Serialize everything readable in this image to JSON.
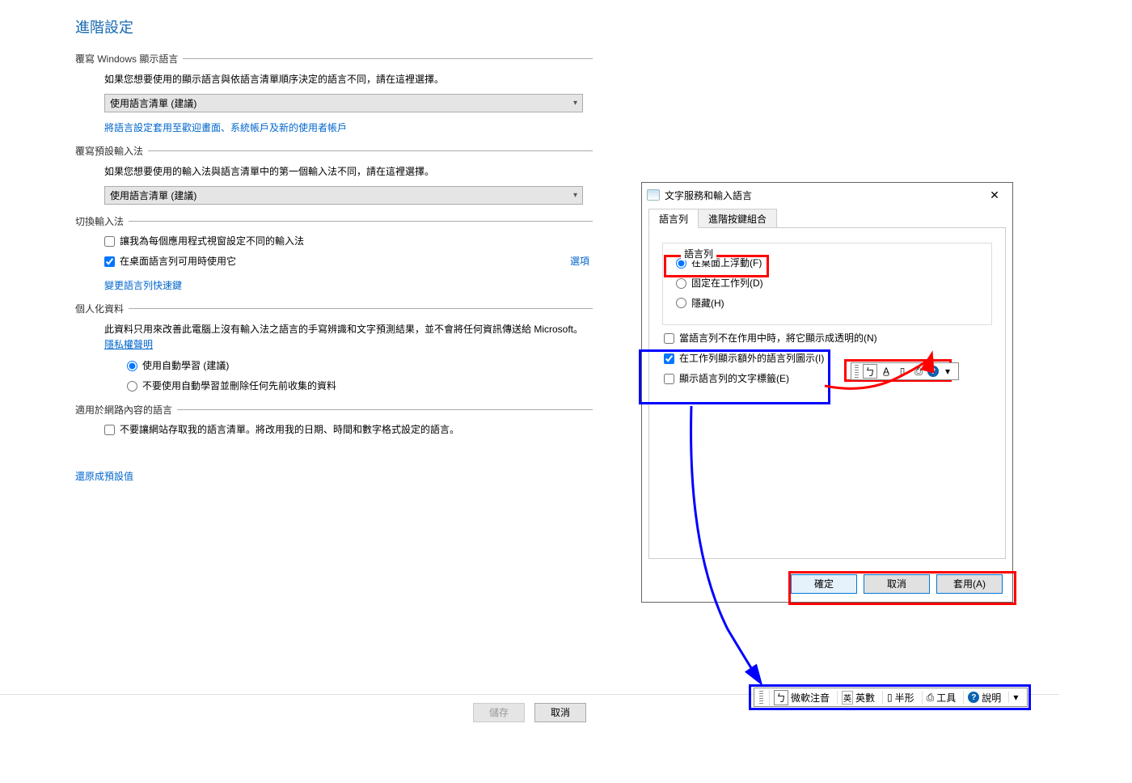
{
  "page": {
    "title": "進階設定"
  },
  "sec1": {
    "header": "覆寫 Windows 顯示語言",
    "desc": "如果您想要使用的顯示語言與依語言清單順序決定的語言不同，請在這裡選擇。",
    "dropdown": "使用語言清單 (建議)",
    "link": "將語言設定套用至歡迎畫面、系統帳戶及新的使用者帳戶"
  },
  "sec2": {
    "header": "覆寫預設輸入法",
    "desc": "如果您想要使用的輸入法與語言清單中的第一個輸入法不同，請在這裡選擇。",
    "dropdown": "使用語言清單 (建議)"
  },
  "sec3": {
    "header": "切換輸入法",
    "chk1": "讓我為每個應用程式視窗設定不同的輸入法",
    "chk2": "在桌面語言列可用時使用它",
    "options": "選項",
    "link": "變更語言列快速鍵"
  },
  "sec4": {
    "header": "個人化資料",
    "desc1": "此資料只用來改善此電腦上沒有輸入法之語言的手寫辨識和文字預測結果，並不會將任何資訊傳送給 Microsoft。",
    "privacy": "隱私權聲明",
    "radio1": "使用自動學習 (建議)",
    "radio2": "不要使用自動學習並刪除任何先前收集的資料"
  },
  "sec5": {
    "header": "適用於網路內容的語言",
    "chk": "不要讓網站存取我的語言清單。將改用我的日期、時間和數字格式設定的語言。"
  },
  "restore": "還原成預設值",
  "bottom": {
    "save": "儲存",
    "cancel": "取消"
  },
  "dialog": {
    "title": "文字服務和輸入語言",
    "close": "✕",
    "tab1": "語言列",
    "tab2": "進階按鍵組合",
    "fieldset": "語言列",
    "radio_float": "在桌面上浮動(F)",
    "radio_dock": "固定在工作列(D)",
    "radio_hidden": "隱藏(H)",
    "chk_inactive": "當語言列不在作用中時，將它顯示成透明的(N)",
    "chk_extra": "在工作列顯示額外的語言列圖示(I)",
    "chk_textlabel": "顯示語言列的文字標籤(E)",
    "ok": "確定",
    "cancel": "取消",
    "apply": "套用(A)"
  },
  "ime_small": {
    "i1": "ㄅ",
    "i2": "A̲",
    "i3": "▯",
    "i4": "⎙",
    "i5_help": "?"
  },
  "ime_large": {
    "ime_name": "微軟注音",
    "eng": "英數",
    "eng_icon": "英",
    "half": "半形",
    "half_icon": "▯",
    "tools": "工具",
    "tools_icon": "⎙",
    "help": "說明"
  }
}
